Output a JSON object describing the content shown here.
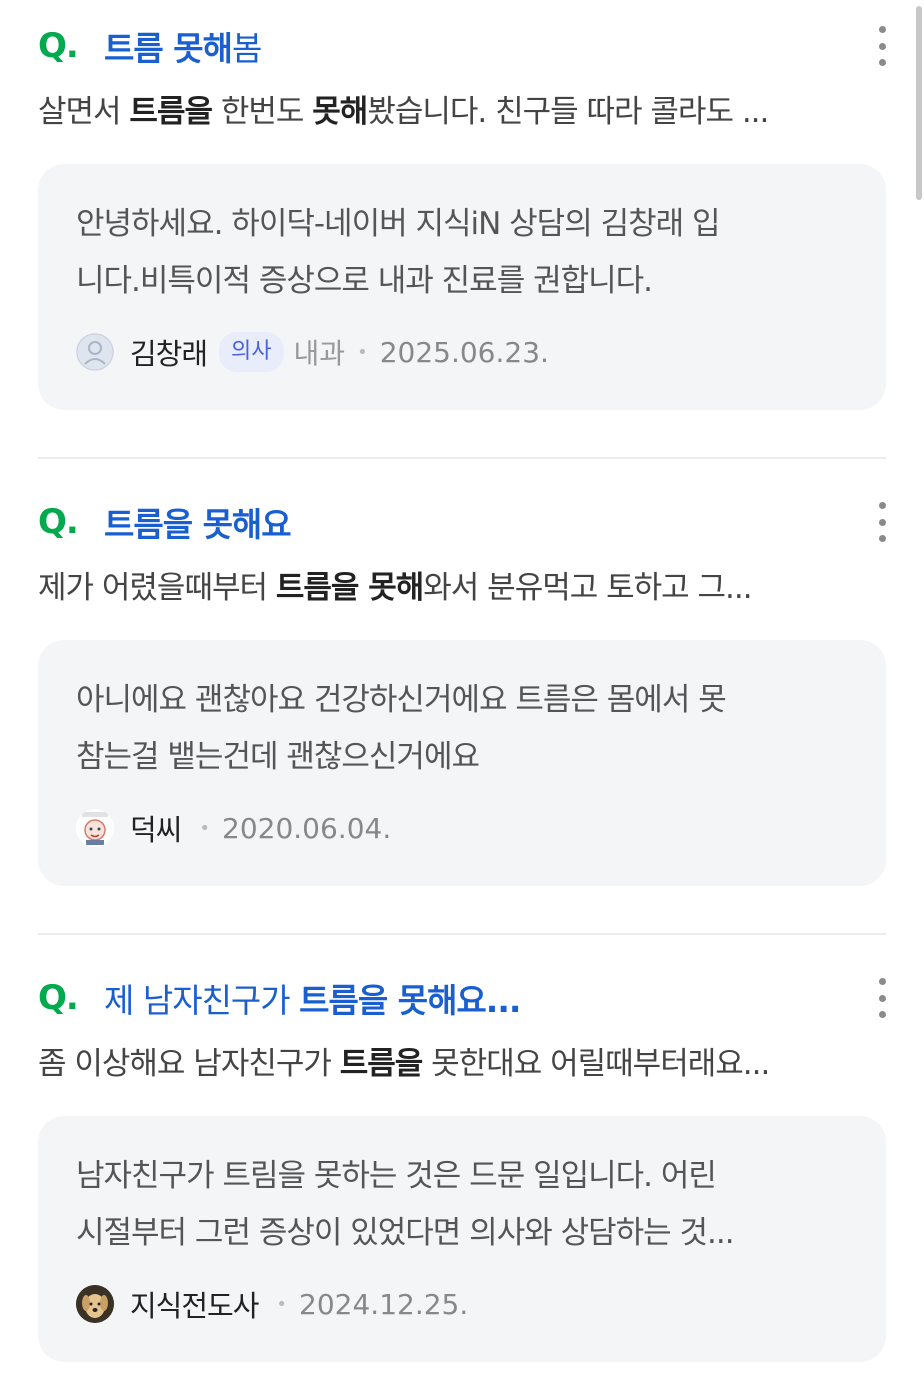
{
  "results": [
    {
      "q_mark": "Q.",
      "title_bold": "트름 못해",
      "title_normal": "봄",
      "snippet_pre": "살면서 ",
      "snippet_b1": "트름을",
      "snippet_mid": " 한번도 ",
      "snippet_b2": "못해",
      "snippet_post": "봤습니다. 친구들 따라 콜라도 ...",
      "answer_lines": [
        "안녕하세요. 하이닥-네이버 지식iN 상담의 김창래 입",
        "니다.비특이적 증상으로 내과 진료를 권합니다."
      ],
      "author": "김창래",
      "badge": "의사",
      "dept": "내과",
      "date": "2025.06.23.",
      "avatar_icon": "doctor-avatar-icon"
    },
    {
      "q_mark": "Q.",
      "title_bold": "트름을 못해요",
      "snippet_pre": "제가 어렸을때부터 ",
      "snippet_b1": "트름을 못해",
      "snippet_post": "와서 분유먹고 토하고 그...",
      "answer_lines": [
        "아니에요 괜찮아요 건강하신거에요 트름은 몸에서 못",
        "참는걸 뱉는건데 괜찮으신거에요"
      ],
      "author": "덕씨",
      "date": "2020.06.04.",
      "avatar_icon": "cartoon-avatar-icon"
    },
    {
      "q_mark": "Q.",
      "title_normal": "제 남자친구가 ",
      "title_bold": "트름을 못해요...",
      "snippet_pre": "좀 이상해요 남자친구가 ",
      "snippet_b1": "트름을",
      "snippet_post": " 못한대요 어릴때부터래요...",
      "answer_lines": [
        "남자친구가 트림을 못하는 것은 드문 일입니다. 어린",
        "시절부터 그런 증상이 있었다면 의사와 상담하는 것..."
      ],
      "author": "지식전도사",
      "date": "2024.12.25.",
      "avatar_icon": "dog-avatar-icon"
    }
  ],
  "separator_dot": "•",
  "colors": {
    "q_mark": "#03a94d",
    "title": "#1a5fd0",
    "card_bg": "#f4f5f7",
    "badge_bg": "#e8ecfb",
    "badge_text": "#4a63d8"
  }
}
